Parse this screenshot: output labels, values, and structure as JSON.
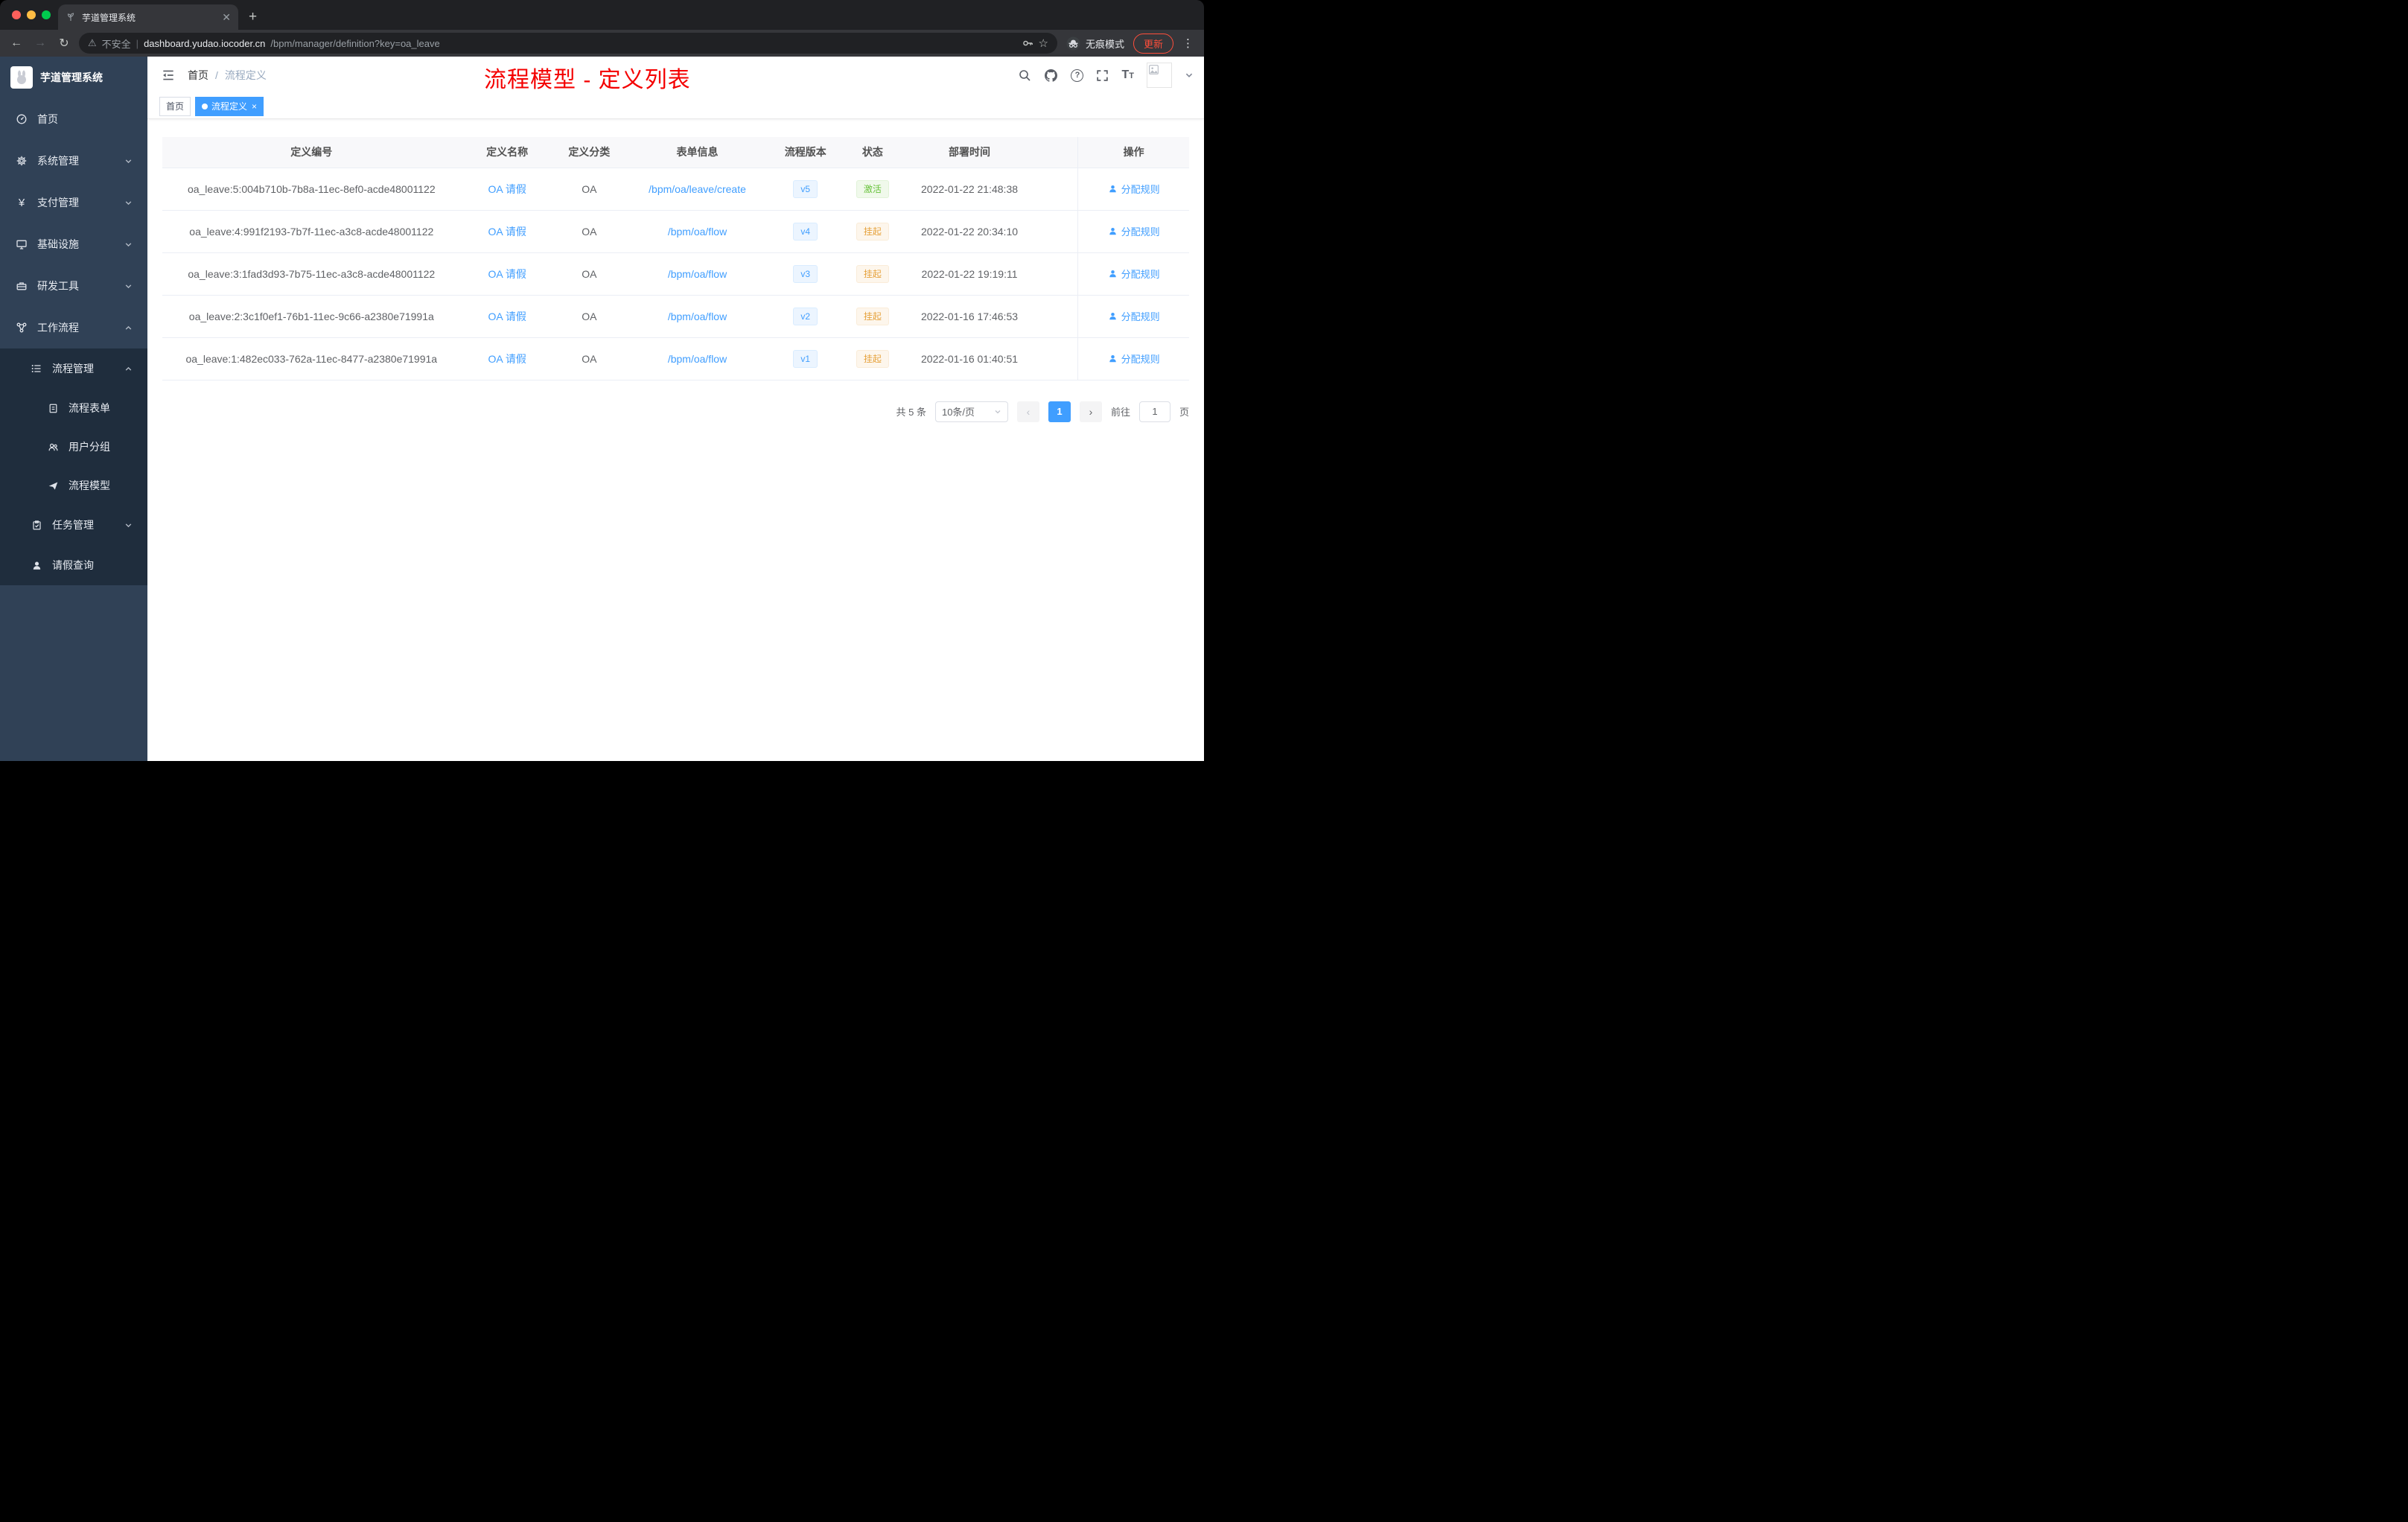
{
  "browser": {
    "tab_title": "芋道管理系统",
    "security_label": "不安全",
    "url_host": "dashboard.yudao.iocoder.cn",
    "url_path": "/bpm/manager/definition?key=oa_leave",
    "incognito_label": "无痕模式",
    "update_label": "更新"
  },
  "sidebar": {
    "logo_title": "芋道管理系统",
    "items": [
      {
        "label": "首页",
        "icon": "dashboard-icon",
        "expandable": false
      },
      {
        "label": "系统管理",
        "icon": "gear-icon",
        "expandable": true,
        "state": "collapsed"
      },
      {
        "label": "支付管理",
        "icon": "yen-icon",
        "expandable": true,
        "state": "collapsed"
      },
      {
        "label": "基础设施",
        "icon": "monitor-icon",
        "expandable": true,
        "state": "collapsed"
      },
      {
        "label": "研发工具",
        "icon": "toolbox-icon",
        "expandable": true,
        "state": "collapsed"
      },
      {
        "label": "工作流程",
        "icon": "workflow-icon",
        "expandable": true,
        "state": "expanded"
      },
      {
        "label": "流程管理",
        "icon": "tree-list-icon",
        "expandable": true,
        "state": "expanded",
        "level": 2
      },
      {
        "label": "流程表单",
        "icon": "form-icon",
        "level": 3
      },
      {
        "label": "用户分组",
        "icon": "users-icon",
        "level": 3
      },
      {
        "label": "流程模型",
        "icon": "send-icon",
        "level": 3
      },
      {
        "label": "任务管理",
        "icon": "task-icon",
        "expandable": true,
        "state": "collapsed",
        "level": 2
      },
      {
        "label": "请假查询",
        "icon": "user-icon",
        "level": 2
      }
    ]
  },
  "header": {
    "breadcrumb": [
      "首页",
      "流程定义"
    ],
    "breadcrumb_separator": "/",
    "annotation": "流程模型 - 定义列表"
  },
  "tags": [
    {
      "label": "首页",
      "active": false
    },
    {
      "label": "流程定义",
      "active": true
    }
  ],
  "table": {
    "columns": [
      "定义编号",
      "定义名称",
      "定义分类",
      "表单信息",
      "流程版本",
      "状态",
      "部署时间",
      "操作"
    ],
    "rows": [
      {
        "id": "oa_leave:5:004b710b-7b8a-11ec-8ef0-acde48001122",
        "name": "OA 请假",
        "category": "OA",
        "form": "/bpm/oa/leave/create",
        "version": "v5",
        "status": "激活",
        "status_type": "success",
        "deploy_time": "2022-01-22 21:48:38",
        "action": "分配规则"
      },
      {
        "id": "oa_leave:4:991f2193-7b7f-11ec-a3c8-acde48001122",
        "name": "OA 请假",
        "category": "OA",
        "form": "/bpm/oa/flow",
        "version": "v4",
        "status": "挂起",
        "status_type": "warning",
        "deploy_time": "2022-01-22 20:34:10",
        "action": "分配规则"
      },
      {
        "id": "oa_leave:3:1fad3d93-7b75-11ec-a3c8-acde48001122",
        "name": "OA 请假",
        "category": "OA",
        "form": "/bpm/oa/flow",
        "version": "v3",
        "status": "挂起",
        "status_type": "warning",
        "deploy_time": "2022-01-22 19:19:11",
        "action": "分配规则"
      },
      {
        "id": "oa_leave:2:3c1f0ef1-76b1-11ec-9c66-a2380e71991a",
        "name": "OA 请假",
        "category": "OA",
        "form": "/bpm/oa/flow",
        "version": "v2",
        "status": "挂起",
        "status_type": "warning",
        "deploy_time": "2022-01-16 17:46:53",
        "action": "分配规则"
      },
      {
        "id": "oa_leave:1:482ec033-762a-11ec-8477-a2380e71991a",
        "name": "OA 请假",
        "category": "OA",
        "form": "/bpm/oa/flow",
        "version": "v1",
        "status": "挂起",
        "status_type": "warning",
        "deploy_time": "2022-01-16 01:40:51",
        "action": "分配规则"
      }
    ]
  },
  "pagination": {
    "total": "共 5 条",
    "page_size": "10条/页",
    "current_page": "1",
    "goto_label": "前往",
    "goto_value": "1",
    "unit_label": "页"
  },
  "colors": {
    "accent": "#409eff",
    "success": "#67c23a",
    "warning": "#e6a23c",
    "annotation": "#f40000",
    "sidebar": "#304156",
    "submenu": "#1f2d3d"
  }
}
